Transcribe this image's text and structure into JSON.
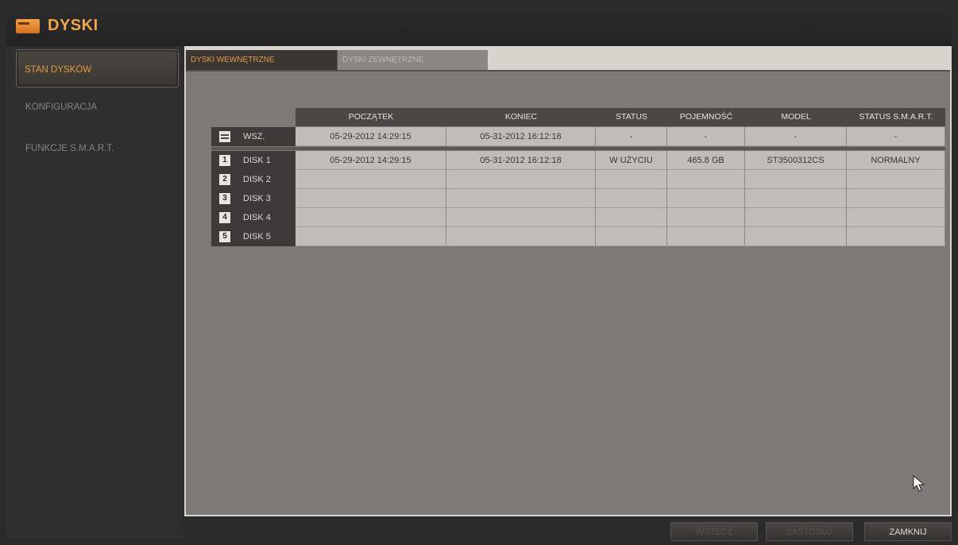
{
  "title": "DYSKI",
  "sidebar": {
    "items": [
      {
        "label": "STAN DYSKÓW"
      },
      {
        "label": "KONFIGURACJA"
      },
      {
        "label": "FUNKCJE S.M.A.R.T."
      }
    ]
  },
  "tabs": [
    {
      "label": "DYSKI WEWNĘTRZNE"
    },
    {
      "label": "DYSKI ZEWNĘTRZNE"
    }
  ],
  "table": {
    "headers": [
      "POCZĄTEK",
      "KONIEC",
      "STATUS",
      "POJEMNOŚĆ",
      "MODEL",
      "STATUS S.M.A.R.T."
    ],
    "all_row": {
      "label": "WSZ.",
      "cells": [
        "05-29-2012  14:29:15",
        "05-31-2012  16:12:18",
        "-",
        "-",
        "-",
        "-"
      ]
    },
    "rows": [
      {
        "num": "1",
        "label": "DISK 1",
        "cells": [
          "05-29-2012  14:29:15",
          "05-31-2012  16:12:18",
          "W UŻYCIU",
          "465.8 GB",
          "ST3500312CS",
          "NORMALNY"
        ]
      },
      {
        "num": "2",
        "label": "DISK 2",
        "cells": [
          "",
          "",
          "",
          "",
          "",
          ""
        ]
      },
      {
        "num": "3",
        "label": "DISK 3",
        "cells": [
          "",
          "",
          "",
          "",
          "",
          ""
        ]
      },
      {
        "num": "4",
        "label": "DISK 4",
        "cells": [
          "",
          "",
          "",
          "",
          "",
          ""
        ]
      },
      {
        "num": "5",
        "label": "DISK 5",
        "cells": [
          "",
          "",
          "",
          "",
          "",
          ""
        ]
      }
    ]
  },
  "buttons": {
    "prev": "WSTECZ",
    "apply": "ZASTOSUJ",
    "close": "ZAMKNIJ"
  },
  "colors": {
    "accent": "#e29a42",
    "panel": "#7d7a76",
    "cell": "#c0bdb8",
    "header": "#4a4744"
  }
}
